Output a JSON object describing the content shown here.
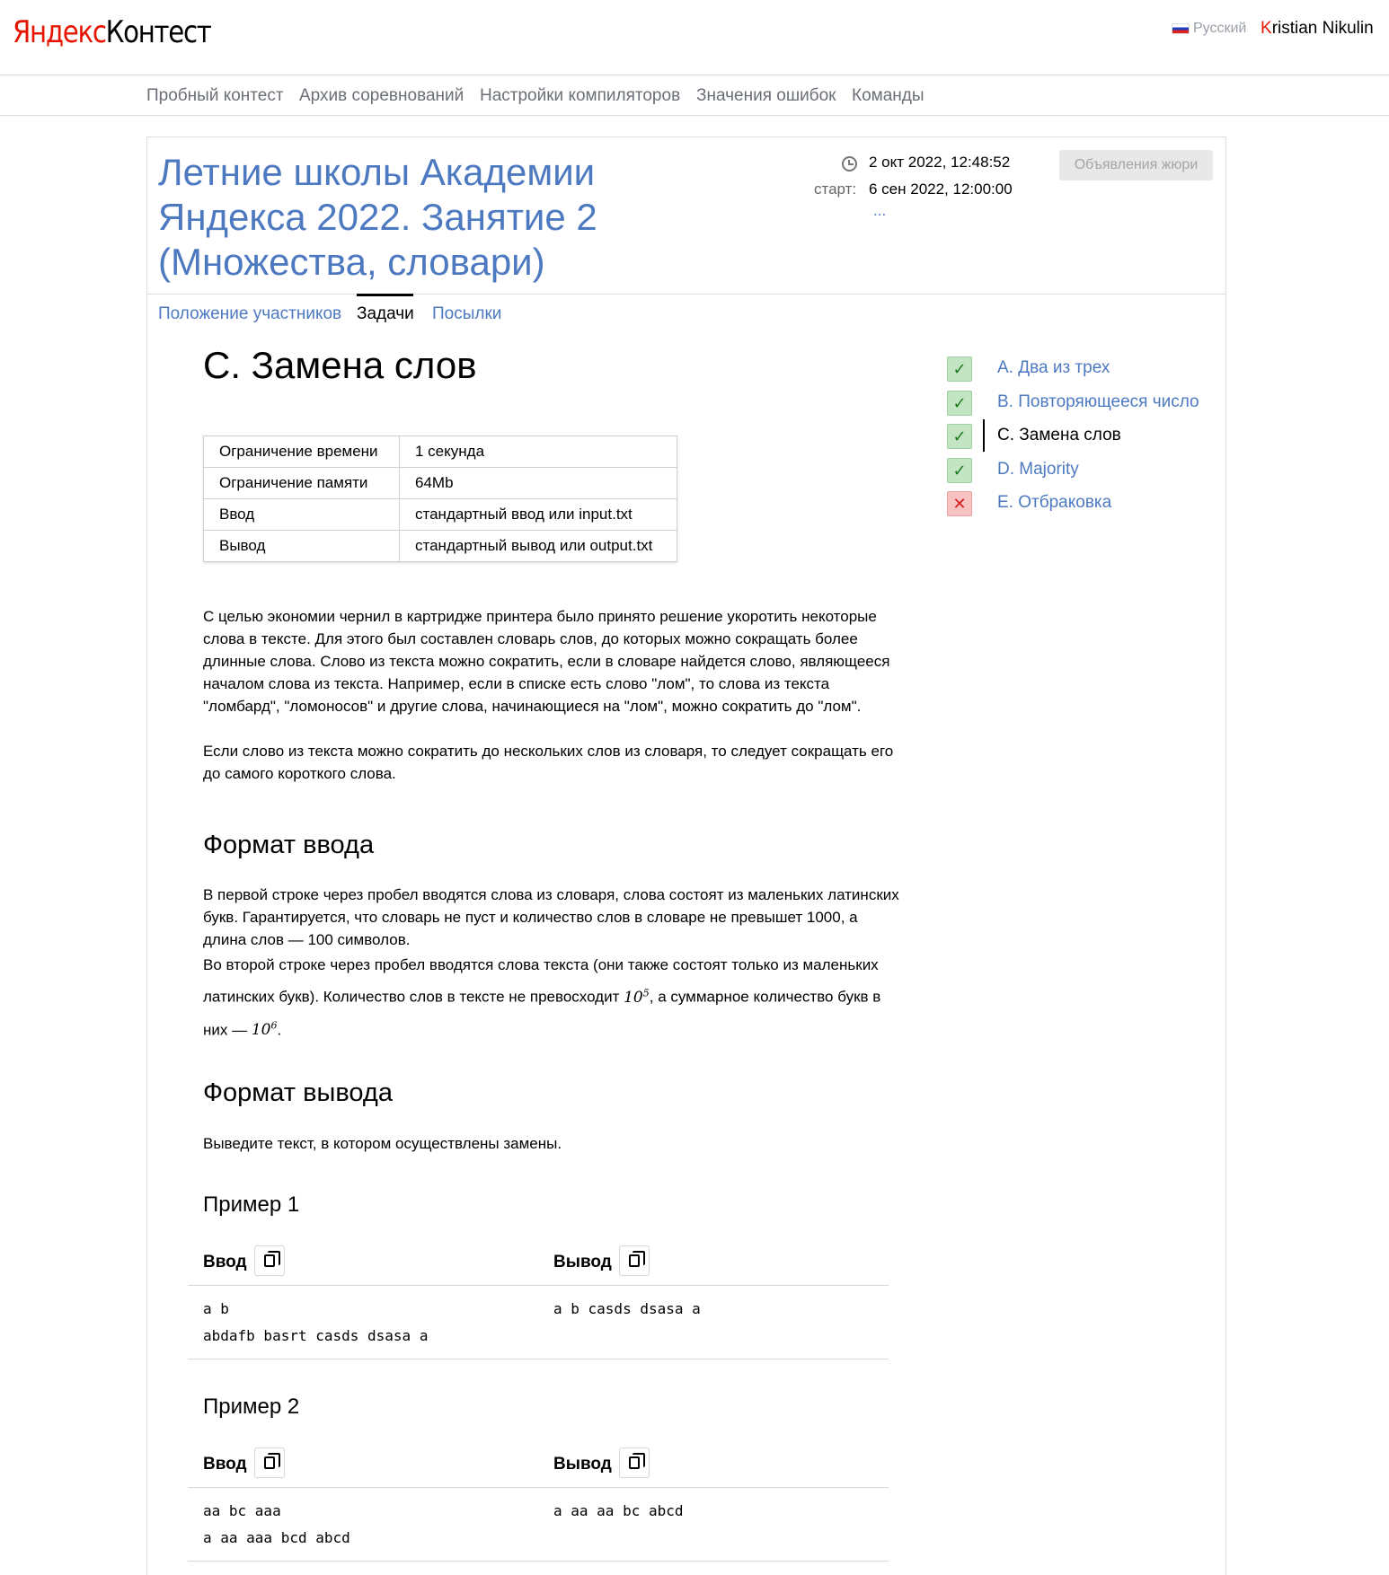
{
  "header": {
    "logo_part1": "Яндекс",
    "logo_part2": "Контест",
    "language": "Русский",
    "user_first_letter": "K",
    "user_rest": "ristian Nikulin"
  },
  "nav": {
    "items": [
      "Пробный контест",
      "Архив соревнований",
      "Настройки компиляторов",
      "Значения ошибок",
      "Команды"
    ]
  },
  "contest": {
    "title": "Летние школы Академии Яндекса 2022. Занятие 2 (Множества, словари)",
    "current_time": "2 окт 2022, 12:48:52",
    "start_label": "старт:",
    "start_time": "6 сен 2022, 12:00:00",
    "more": "...",
    "jury_button": "Объявления жюри",
    "tabs": [
      "Положение участников",
      "Задачи",
      "Посылки"
    ]
  },
  "problem": {
    "title": "C. Замена слов",
    "limits": [
      {
        "key": "Ограничение времени",
        "value": "1 секунда"
      },
      {
        "key": "Ограничение памяти",
        "value": "64Mb"
      },
      {
        "key": "Ввод",
        "value": "стандартный ввод или input.txt"
      },
      {
        "key": "Вывод",
        "value": "стандартный вывод или output.txt"
      }
    ],
    "statement_p1": "С целью экономии чернил в картридже принтера было принято решение укоротить некоторые слова в тексте. Для этого был составлен словарь слов, до которых можно сокращать более длинные слова. Слово из текста можно сократить, если в словаре найдется слово, являющееся началом слова из текста. Например, если в списке есть слово \"лом\", то слова из текста \"ломбард\", \"ломоносов\" и другие слова, начинающиеся на \"лом\", можно сократить до \"лом\".",
    "statement_p2": "Если слово из текста можно сократить до нескольких слов из словаря, то следует сокращать его до самого короткого слова.",
    "input_format_title": "Формат ввода",
    "input_format_p1": "В первой строке через пробел вводятся слова из словаря, слова состоят из маленьких латинских букв. Гарантируется, что словарь не пуст и количество слов в словаре не превышет 1000, а длина слов — 100 символов.",
    "input_format_p2_a": "Во второй строке через пробел вводятся слова текста (они также состоят только из маленьких латинских букв). Количество слов в тексте не превосходит ",
    "input_format_p2_math1_base": "10",
    "input_format_p2_math1_exp": "5",
    "input_format_p2_b": ", а суммарное количество букв в них — ",
    "input_format_p2_math2_base": "10",
    "input_format_p2_math2_exp": "6",
    "input_format_p2_c": ".",
    "output_format_title": "Формат вывода",
    "output_format_text": "Выведите текст, в котором осуществлены замены.",
    "examples": [
      {
        "title": "Пример 1",
        "input_label": "Ввод",
        "output_label": "Вывод",
        "input": "a b\nabdafb basrt casds dsasa a",
        "output": "a b casds dsasa a"
      },
      {
        "title": "Пример 2",
        "input_label": "Ввод",
        "output_label": "Вывод",
        "input": "aa bc aaa\na aa aaa bcd abcd",
        "output": "a aa aa bc abcd"
      }
    ]
  },
  "problem_list": [
    {
      "label": "A. Два из трех",
      "status": "ok",
      "current": false
    },
    {
      "label": "B. Повторяющееся число",
      "status": "ok",
      "current": false
    },
    {
      "label": "C. Замена слов",
      "status": "ok",
      "current": true
    },
    {
      "label": "D. Majority",
      "status": "ok",
      "current": false
    },
    {
      "label": "E. Отбраковка",
      "status": "fail",
      "current": false
    }
  ],
  "colors": {
    "link": "#4d79c1",
    "brand_red": "#e61400",
    "ok_bg": "#c3e5c3",
    "fail_bg": "#f7c2c2"
  }
}
